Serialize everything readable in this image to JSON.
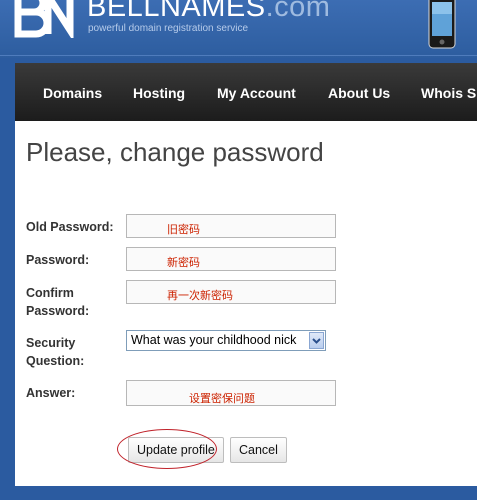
{
  "header": {
    "brand_name": "BELLNAMES",
    "brand_tld": ".com",
    "tagline": "powerful domain registration service",
    "logo_icon": "bn-logo-icon",
    "device_icon": "mobile-phone-icon"
  },
  "nav": {
    "items": [
      {
        "label": "Domains"
      },
      {
        "label": "Hosting"
      },
      {
        "label": "My Account"
      },
      {
        "label": "About Us"
      },
      {
        "label": "Whois S"
      }
    ]
  },
  "page": {
    "title": "Please, change password"
  },
  "form": {
    "old_password": {
      "label": "Old Password:",
      "value": "旧密码"
    },
    "password": {
      "label": "Password:",
      "value": "新密码"
    },
    "confirm_password": {
      "label_line1": "Confirm",
      "label_line2": "Password:",
      "value": "再一次新密码"
    },
    "security_question": {
      "label_line1": "Security",
      "label_line2": "Question:",
      "selected": "What was your childhood nick"
    },
    "answer": {
      "label": "Answer:",
      "value": "设置密保问题"
    }
  },
  "buttons": {
    "update": "Update profile",
    "cancel": "Cancel"
  },
  "colors": {
    "header_blue": "#2b5ba0",
    "nav_dark": "#1c1c1c",
    "annotation_red": "#c0222a",
    "field_text_red": "#cc2200"
  }
}
